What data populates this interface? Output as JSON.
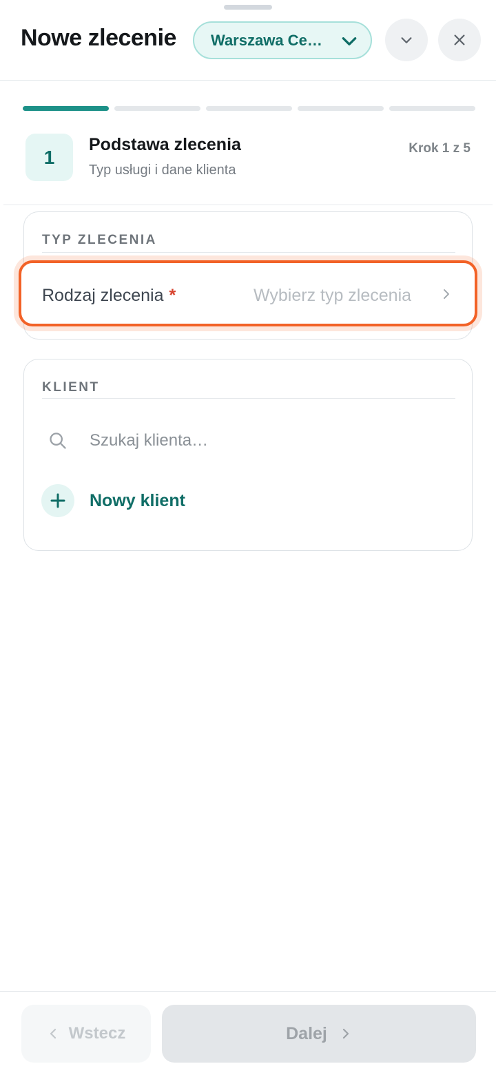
{
  "header": {
    "title": "Nowe zlecenie",
    "branch_selector": "Warszawa Centrum"
  },
  "progress": {
    "total_steps": 5,
    "current_step": 1
  },
  "step": {
    "number": "1",
    "title": "Podstawa zlecenia",
    "subtitle": "Typ usługi i dane klienta",
    "counter": "Krok 1 z 5"
  },
  "order_type_section": {
    "heading": "TYP ZLECENIA",
    "field_label": "Rodzaj zlecenia",
    "required_marker": "*",
    "field_placeholder": "Wybierz typ zlecenia"
  },
  "client_section": {
    "heading": "KLIENT",
    "search_placeholder": "Szukaj klienta…",
    "new_client_label": "Nowy klient"
  },
  "footer": {
    "back_label": "Wstecz",
    "next_label": "Dalej"
  },
  "colors": {
    "accent": "#0f6d66",
    "progress_active": "#1d9188",
    "highlight_border": "#f26227",
    "required": "#d7422e"
  },
  "icons": {
    "branch_dropdown": "chevron-down-icon",
    "collapse": "chevron-down-icon",
    "close": "close-icon",
    "field_arrow": "chevron-right-icon",
    "search": "search-icon",
    "add": "plus-icon",
    "back": "chevron-left-icon",
    "next": "chevron-right-icon"
  }
}
